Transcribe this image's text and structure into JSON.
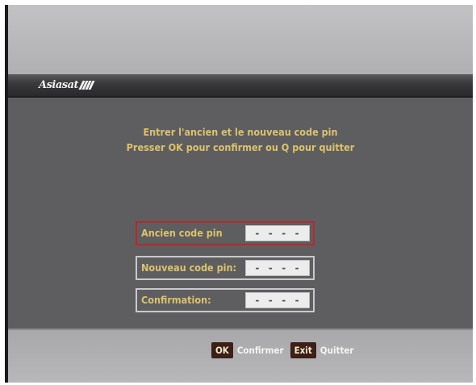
{
  "brand": {
    "logo_text": "Asiasat"
  },
  "instructions": {
    "line1": "Entrer l'ancien et le nouveau code pin",
    "line2": "Presser OK pour confirmer ou Q pour quitter"
  },
  "pin_rows": [
    {
      "label": "Ancien code pin",
      "value": "- - - -",
      "selected": true
    },
    {
      "label": "Nouveau code pin:",
      "value": "- - - -",
      "selected": false
    },
    {
      "label": "Confirmation:",
      "value": "- - - -",
      "selected": false
    }
  ],
  "footer": {
    "ok_key": "OK",
    "ok_action": "Confirmer",
    "exit_key": "Exit",
    "exit_action": "Quitter"
  },
  "colors": {
    "accent_text": "#dcc26a",
    "selection_border": "#b52a2a",
    "key_background": "#3c2018"
  }
}
